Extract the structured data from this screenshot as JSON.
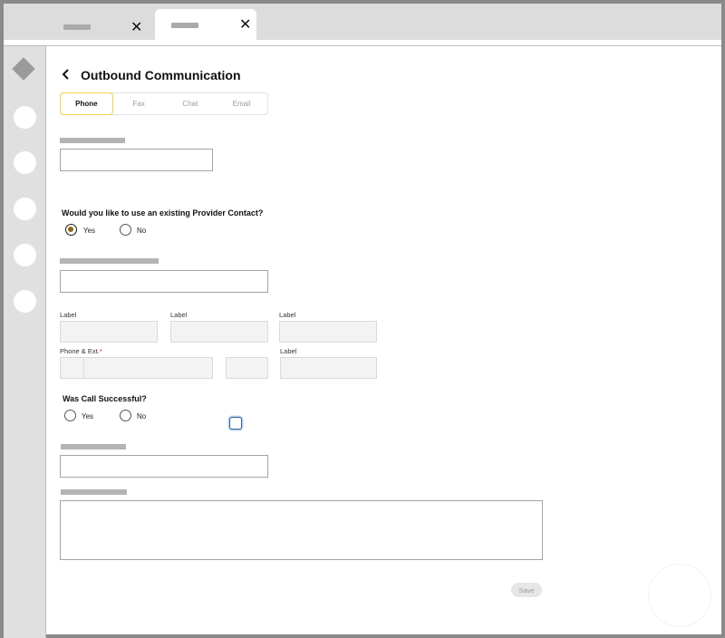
{
  "header": {
    "title": "Outbound Communication"
  },
  "tabs": [
    "Phone",
    "Fax",
    "Chat",
    "Email"
  ],
  "selected_tab": "Phone",
  "questions": {
    "existing_contact": "Would you like to use an existing Provider Contact?",
    "call_successful": "Was Call Successful?"
  },
  "radio_options": {
    "yes": "Yes",
    "no": "No"
  },
  "existing_contact_selected": "Yes",
  "fields": {
    "label_1": "Label",
    "label_2": "Label",
    "label_3": "Label",
    "label_4": "Label",
    "phone_ext": "Phone & Ext.",
    "required_marker": "*"
  },
  "actions": {
    "save": "Save"
  },
  "icons": {
    "back": "chevron-left-icon",
    "close": "close-icon",
    "rail_logo": "diamond-icon"
  },
  "colors": {
    "active_tab_border": "#f0d44a",
    "required": "#c0252a",
    "radio_fill": "#8a6a16",
    "checkbox_focus": "#2f5f8f"
  }
}
